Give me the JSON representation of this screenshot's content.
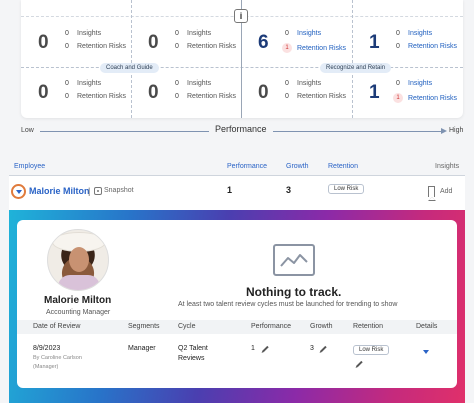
{
  "grid": {
    "info_label": "i",
    "middle_pill_left": "Coach and Guide",
    "middle_pill_right": "Recognize and Retain",
    "cells": [
      {
        "count": "0",
        "insights_count": "0",
        "insights_label": "Insights",
        "risks_count": "0",
        "risks_label": "Retention Risks"
      },
      {
        "count": "0",
        "insights_count": "0",
        "insights_label": "Insights",
        "risks_count": "0",
        "risks_label": "Retention Risks"
      },
      {
        "count": "6",
        "insights_count": "0",
        "insights_label": "Insights",
        "risks_count": "1",
        "risks_label": "Retention Risks"
      },
      {
        "count": "1",
        "insights_count": "0",
        "insights_label": "Insights",
        "risks_count": "0",
        "risks_label": "Retention Risks"
      },
      {
        "count": "0",
        "insights_count": "0",
        "insights_label": "Insights",
        "risks_count": "0",
        "risks_label": "Retention Risks"
      },
      {
        "count": "0",
        "insights_count": "0",
        "insights_label": "Insights",
        "risks_count": "0",
        "risks_label": "Retention Risks"
      },
      {
        "count": "0",
        "insights_count": "0",
        "insights_label": "Insights",
        "risks_count": "0",
        "risks_label": "Retention Risks"
      },
      {
        "count": "1",
        "insights_count": "0",
        "insights_label": "Insights",
        "risks_count": "1",
        "risks_label": "Retention Risks"
      }
    ]
  },
  "axis": {
    "low": "Low",
    "title": "Performance",
    "high": "High"
  },
  "table": {
    "headers": {
      "employee": "Employee",
      "performance": "Performance",
      "growth": "Growth",
      "retention": "Retention",
      "insights": "Insights"
    },
    "row": {
      "name": "Malorie Milton",
      "separator": "|",
      "snapshot": "Snapshot",
      "performance": "1",
      "growth": "3",
      "retention": "Low Risk",
      "add": "Add"
    }
  },
  "detail": {
    "name": "Malorie Milton",
    "role": "Accounting Manager",
    "empty_title": "Nothing to track.",
    "empty_sub": "At least two talent review cycles must be launched for trending to show",
    "headers": {
      "date": "Date of Review",
      "segments": "Segments",
      "cycle": "Cycle",
      "performance": "Performance",
      "growth": "Growth",
      "retention": "Retention",
      "details": "Details"
    },
    "row": {
      "date": "8/9/2023",
      "by": "By Caroline Carlson",
      "by_role": "(Manager)",
      "segment": "Manager",
      "cycle_line1": "Q2 Talent",
      "cycle_line2": "Reviews",
      "performance": "1",
      "growth": "3",
      "retention": "Low Risk"
    }
  },
  "colors": {
    "accent": "#2a63c6",
    "navy": "#1c3b78",
    "risk_red": "#cc3333",
    "highlight_ring": "#e07b3c"
  }
}
